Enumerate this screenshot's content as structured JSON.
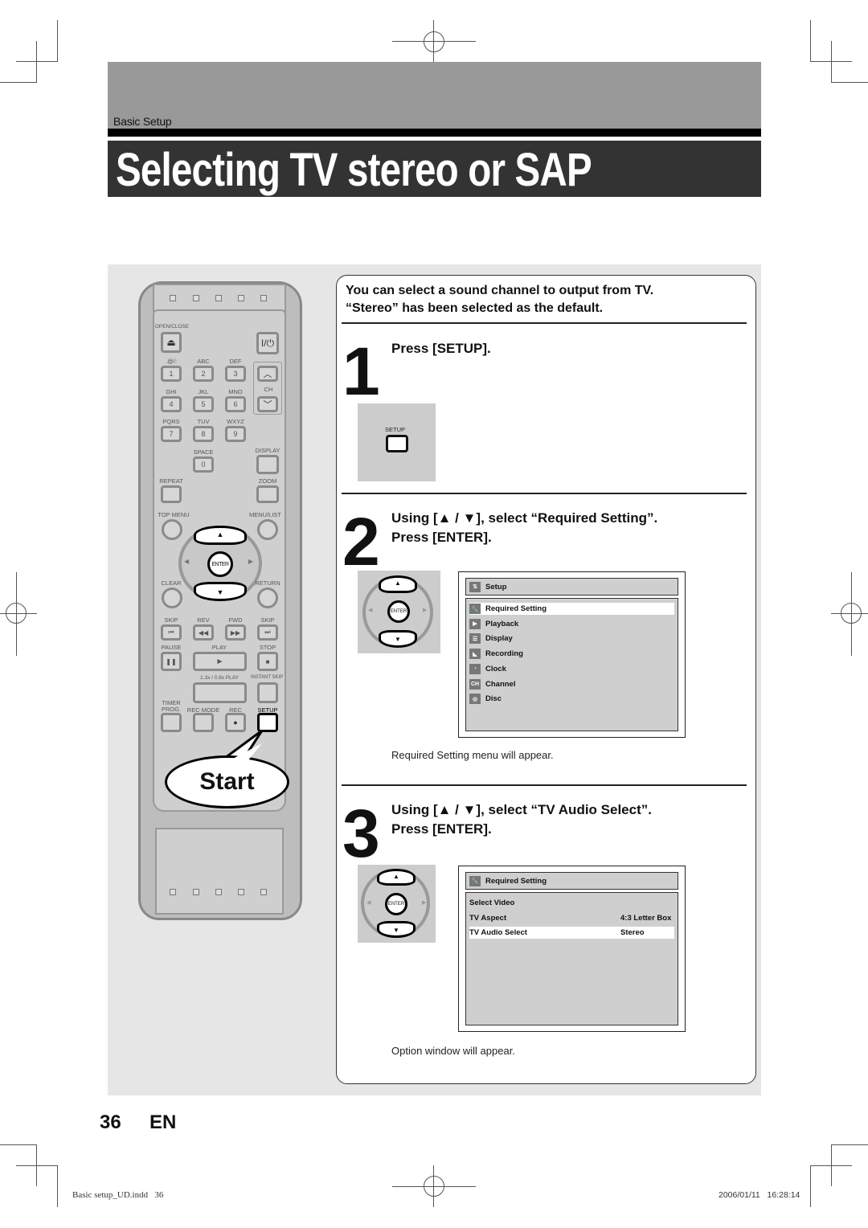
{
  "header": {
    "section": "Basic Setup",
    "title": "Selecting TV stereo or SAP"
  },
  "intro": {
    "line1": "You can select a sound channel to output from TV.",
    "line2": "“Stereo” has been selected as the default."
  },
  "steps": [
    {
      "number": "1",
      "text": "Press [SETUP].",
      "button_label": "SETUP"
    },
    {
      "number": "2",
      "line1": "Using [▲ / ▼], select “Required Setting”.",
      "line2": "Press [ENTER].",
      "note": "Required Setting menu will appear."
    },
    {
      "number": "3",
      "line1": "Using [▲ / ▼], select “TV Audio Select”.",
      "line2": "Press [ENTER].",
      "note": "Option window will appear."
    }
  ],
  "dpad": {
    "center": "ENTER",
    "up": "▲",
    "down": "▼",
    "left": "◀",
    "right": "▶"
  },
  "setup_menu": {
    "title": "Setup",
    "items": [
      {
        "label": "Required Setting",
        "icon": "wrench-icon",
        "glyph": "🔧",
        "selected": true
      },
      {
        "label": "Playback",
        "icon": "play-icon",
        "glyph": "▶",
        "selected": false
      },
      {
        "label": "Display",
        "icon": "display-icon",
        "glyph": "☰",
        "selected": false
      },
      {
        "label": "Recording",
        "icon": "recording-icon",
        "glyph": "◣",
        "selected": false
      },
      {
        "label": "Clock",
        "icon": "clock-icon",
        "glyph": "◔",
        "selected": false
      },
      {
        "label": "Channel",
        "icon": "channel-icon",
        "glyph": "CH",
        "selected": false
      },
      {
        "label": "Disc",
        "icon": "disc-icon",
        "glyph": "◎",
        "selected": false
      }
    ]
  },
  "required_menu": {
    "title": "Required Setting",
    "rows": [
      {
        "label": "Select Video",
        "value": "",
        "selected": false
      },
      {
        "label": "TV Aspect",
        "value": "4:3 Letter Box",
        "selected": false
      },
      {
        "label": "TV Audio Select",
        "value": "Stereo",
        "selected": true
      }
    ]
  },
  "remote": {
    "labels": {
      "open_close": "OPEN/CLOSE",
      "power": "I/⏻",
      "eject": "⏏",
      "ch": "CH",
      "k1": ".@/:",
      "k2": "ABC",
      "k3": "DEF",
      "k4": "GHI",
      "k5": "JKL",
      "k6": "MNO",
      "k7": "PQRS",
      "k8": "TUV",
      "k9": "WXYZ",
      "k0": "SPACE",
      "display": "DISPLAY",
      "repeat": "REPEAT",
      "zoom": "ZOOM",
      "top_menu": "TOP MENU",
      "menu_list": "MENU/LIST",
      "clear": "CLEAR",
      "return": "RETURN",
      "skip_back": "SKIP",
      "rev": "REV",
      "fwd": "FWD",
      "skip_fwd": "SKIP",
      "pause": "PAUSE",
      "play": "PLAY",
      "stop": "STOP",
      "speed_play": "1.3x / 0.8x PLAY",
      "instant_skip": "INSTANT SKIP",
      "timer_prog": "TIMER PROG.",
      "rec_mode": "REC MODE",
      "rec": "REC",
      "setup": "SETUP"
    },
    "digits": [
      "1",
      "2",
      "3",
      "4",
      "5",
      "6",
      "7",
      "8",
      "9",
      "0"
    ],
    "callout": "Start"
  },
  "footer": {
    "page": "36",
    "lang": "EN",
    "slug_file": "Basic setup_UD.indd   36",
    "slug_date": "2006/01/11   16:28:14"
  }
}
